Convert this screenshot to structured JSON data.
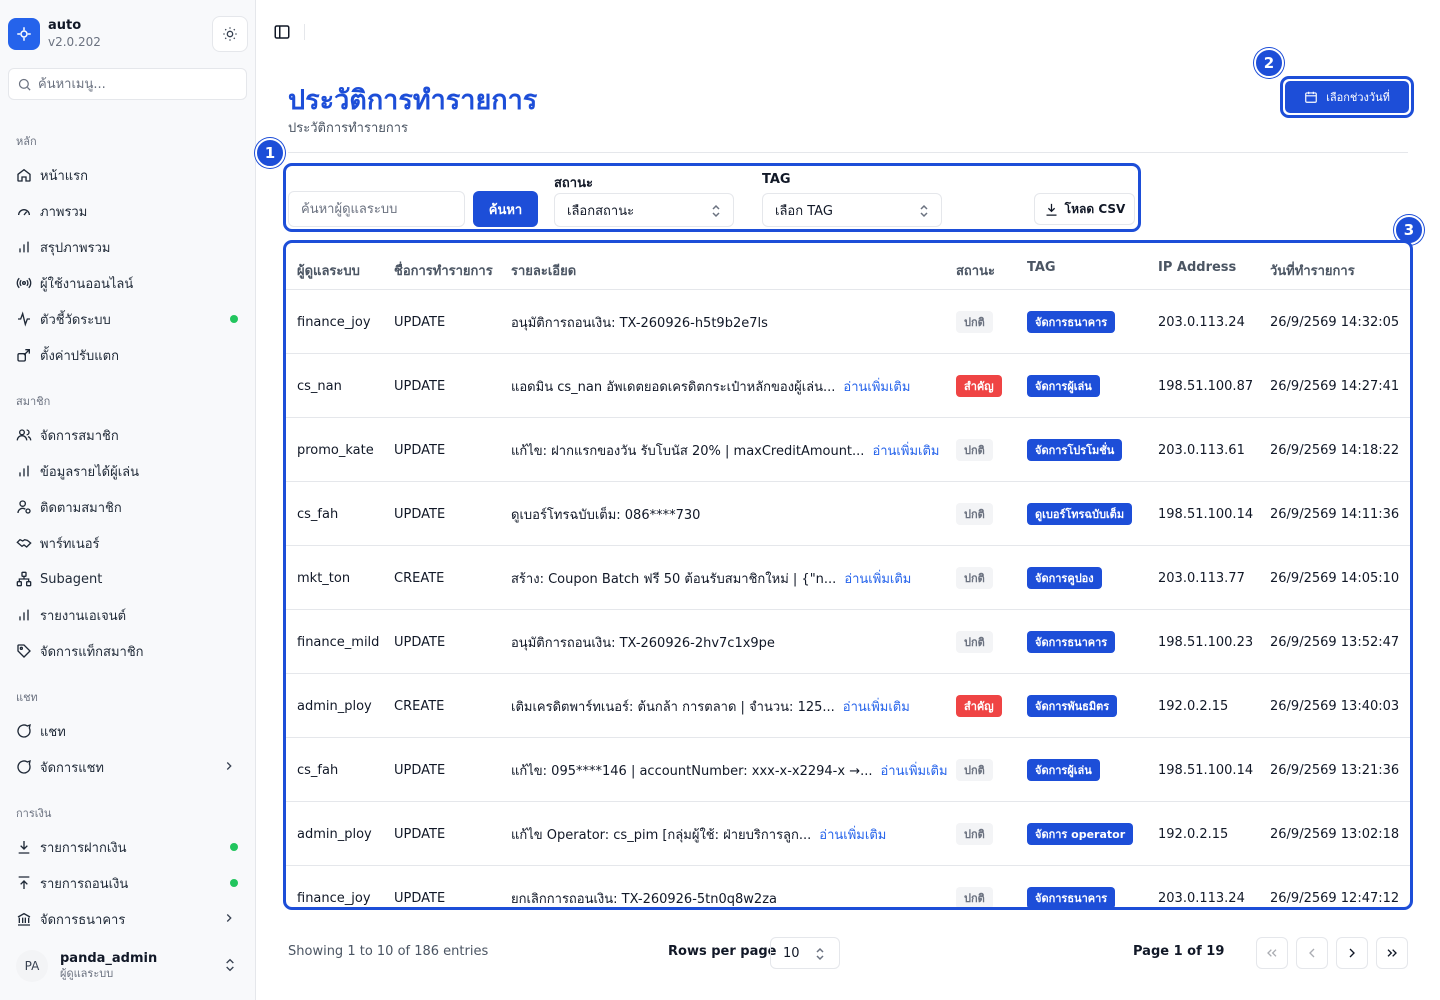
{
  "app": {
    "name": "auto",
    "version": "v2.0.202"
  },
  "sidebar": {
    "search_placeholder": "ค้นหาเมนู...",
    "sections": [
      {
        "title": "หลัก",
        "items": [
          {
            "label": "หน้าแรก",
            "icon": "home-icon"
          },
          {
            "label": "ภาพรวม",
            "icon": "gauge-icon"
          },
          {
            "label": "สรุปภาพรวม",
            "icon": "bar-chart-icon"
          },
          {
            "label": "ผู้ใช้งานออนไลน์",
            "icon": "broadcast-icon"
          },
          {
            "label": "ตัวชี้วัดระบบ",
            "icon": "activity-icon",
            "status_dot": true
          },
          {
            "label": "ตั้งค่าปรับแตก",
            "icon": "settings-share-icon"
          }
        ]
      },
      {
        "title": "สมาชิก",
        "items": [
          {
            "label": "จัดการสมาชิก",
            "icon": "users-icon"
          },
          {
            "label": "ข้อมูลรายได้ผู้เล่น",
            "icon": "bar-chart-icon"
          },
          {
            "label": "ติดตามสมาชิก",
            "icon": "user-search-icon"
          },
          {
            "label": "พาร์ทเนอร์",
            "icon": "handshake-icon"
          },
          {
            "label": "Subagent",
            "icon": "network-icon"
          },
          {
            "label": "รายงานเอเจนต์",
            "icon": "bar-chart-icon"
          },
          {
            "label": "จัดการแท็กสมาชิก",
            "icon": "tag-icon"
          }
        ]
      },
      {
        "title": "แชท",
        "items": [
          {
            "label": "แชท",
            "icon": "chat-icon"
          },
          {
            "label": "จัดการแชท",
            "icon": "chat-icon",
            "has_children": true
          }
        ]
      },
      {
        "title": "การเงิน",
        "items": [
          {
            "label": "รายการฝากเงิน",
            "icon": "download-icon",
            "status_dot": true
          },
          {
            "label": "รายการถอนเงิน",
            "icon": "upload-icon",
            "status_dot": true
          },
          {
            "label": "จัดการธนาคาร",
            "icon": "bank-icon",
            "has_children": true
          }
        ]
      }
    ],
    "user": {
      "initials": "PA",
      "name": "panda_admin",
      "role": "ผู้ดูแลระบบ"
    }
  },
  "header": {
    "title": "ประวัติการทำรายการ",
    "subtitle": "ประวัติการทำรายการ",
    "date_button": "เลือกช่วงวันที่"
  },
  "filters": {
    "search_placeholder": "ค้นหาผู้ดูแลระบบ",
    "search_button": "ค้นหา",
    "status_label": "สถานะ",
    "status_placeholder": "เลือกสถานะ",
    "tag_label": "TAG",
    "tag_placeholder": "เลือก TAG",
    "csv_button": "โหลด CSV"
  },
  "callouts": [
    "1",
    "2",
    "3"
  ],
  "table": {
    "columns": [
      "ผู้ดูแลระบบ",
      "ชื่อการทำรายการ",
      "รายละเอียด",
      "สถานะ",
      "TAG",
      "IP Address",
      "วันที่ทำรายการ"
    ],
    "read_more": "อ่านเพิ่มเติม",
    "rows": [
      {
        "admin": "finance_joy",
        "action": "UPDATE",
        "detail": "อนุมัติการถอนเงิน: TX-260926-h5t9b2e7ls",
        "more": false,
        "status": "ปกติ",
        "important": false,
        "tag": "จัดการธนาคาร",
        "ip": "203.0.113.24",
        "date": "26/9/2569 14:32:05"
      },
      {
        "admin": "cs_nan",
        "action": "UPDATE",
        "detail": "แอดมิน cs_nan อัพเดตยอดเครดิตกระเป๋าหลักของผู้เล่น...",
        "more": true,
        "status": "สำคัญ",
        "important": true,
        "tag": "จัดการผู้เล่น",
        "ip": "198.51.100.87",
        "date": "26/9/2569 14:27:41"
      },
      {
        "admin": "promo_kate",
        "action": "UPDATE",
        "detail": "แก้ไข: ฝากแรกของวัน รับโบนัส 20% | maxCreditAmount...",
        "more": true,
        "status": "ปกติ",
        "important": false,
        "tag": "จัดการโปรโมชั่น",
        "ip": "203.0.113.61",
        "date": "26/9/2569 14:18:22"
      },
      {
        "admin": "cs_fah",
        "action": "UPDATE",
        "detail": "ดูเบอร์โทรฉบับเต็ม: 086****730",
        "more": false,
        "status": "ปกติ",
        "important": false,
        "tag": "ดูเบอร์โทรฉบับเต็ม",
        "ip": "198.51.100.14",
        "date": "26/9/2569 14:11:36"
      },
      {
        "admin": "mkt_ton",
        "action": "CREATE",
        "detail": "สร้าง: Coupon Batch ฟรี 50 ต้อนรับสมาชิกใหม่ | {\"n...",
        "more": true,
        "status": "ปกติ",
        "important": false,
        "tag": "จัดการคูปอง",
        "ip": "203.0.113.77",
        "date": "26/9/2569 14:05:10"
      },
      {
        "admin": "finance_mild",
        "action": "UPDATE",
        "detail": "อนุมัติการถอนเงิน: TX-260926-2hv7c1x9pe",
        "more": false,
        "status": "ปกติ",
        "important": false,
        "tag": "จัดการธนาคาร",
        "ip": "198.51.100.23",
        "date": "26/9/2569 13:52:47"
      },
      {
        "admin": "admin_ploy",
        "action": "CREATE",
        "detail": "เติมเครดิตพาร์ทเนอร์: ต้นกล้า การตลาด | จำนวน: 125...",
        "more": true,
        "status": "สำคัญ",
        "important": true,
        "tag": "จัดการพันธมิตร",
        "ip": "192.0.2.15",
        "date": "26/9/2569 13:40:03"
      },
      {
        "admin": "cs_fah",
        "action": "UPDATE",
        "detail": "แก้ไข: 095****146 | accountNumber: xxx-x-x2294-x →...",
        "more": true,
        "status": "ปกติ",
        "important": false,
        "tag": "จัดการผู้เล่น",
        "ip": "198.51.100.14",
        "date": "26/9/2569 13:21:36"
      },
      {
        "admin": "admin_ploy",
        "action": "UPDATE",
        "detail": "แก้ไข Operator: cs_pim [กลุ่มผู้ใช้: ฝ่ายบริการลูก...",
        "more": true,
        "status": "ปกติ",
        "important": false,
        "tag": "จัดการ operator",
        "ip": "192.0.2.15",
        "date": "26/9/2569 13:02:18"
      },
      {
        "admin": "finance_joy",
        "action": "UPDATE",
        "detail": "ยกเลิกการถอนเงิน: TX-260926-5tn0q8w2za",
        "more": false,
        "status": "ปกติ",
        "important": false,
        "tag": "จัดการธนาคาร",
        "ip": "203.0.113.24",
        "date": "26/9/2569 12:47:12"
      }
    ]
  },
  "pagination": {
    "showing": "Showing 1 to 10 of 186 entries",
    "rows_per_page_label": "Rows per page",
    "rows_per_page": "10",
    "page_info": "Page 1 of 19"
  },
  "colors": {
    "accent": "#1d4ed8",
    "important": "#ef4444",
    "online_dot": "#22c55e"
  }
}
